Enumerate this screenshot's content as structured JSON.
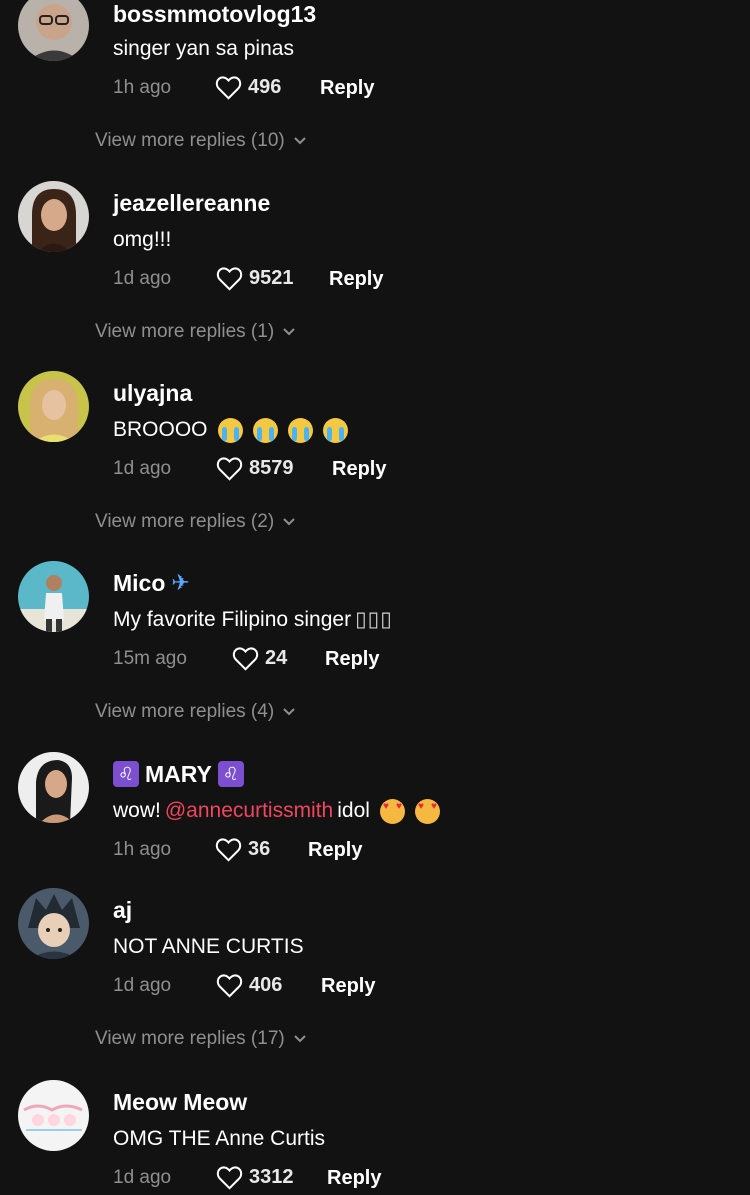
{
  "comments": [
    {
      "username": "bossmmotovlog13",
      "text": "singer yan sa pinas",
      "time": "1h ago",
      "likes": "496",
      "reply_label": "Reply",
      "view_more": "View more replies (10)"
    },
    {
      "username": "jeazellereanne",
      "text": "omg!!!",
      "time": "1d ago",
      "likes": "9521",
      "reply_label": "Reply",
      "view_more": "View more replies (1)"
    },
    {
      "username": "ulyajna",
      "text": "BROOOO",
      "time": "1d ago",
      "likes": "8579",
      "reply_label": "Reply",
      "view_more": "View more replies (2)",
      "emojis": [
        "loudly-crying-face",
        "loudly-crying-face",
        "loudly-crying-face",
        "loudly-crying-face"
      ]
    },
    {
      "username": "Mico",
      "username_icon": "airplane-icon",
      "text": "My favorite Filipino singer",
      "text_suffix": "▯▯▯",
      "time": "15m ago",
      "likes": "24",
      "reply_label": "Reply",
      "view_more": "View more replies (4)"
    },
    {
      "username": "MARY",
      "zodiac_symbol": "♌",
      "text_prefix": "wow!",
      "mention": "@annecurtissmith",
      "text_suffix": "idol",
      "emojis": [
        "smiling-face-with-hearts",
        "smiling-face-with-hearts"
      ],
      "time": "1h ago",
      "likes": "36",
      "reply_label": "Reply"
    },
    {
      "username": "aj",
      "text": "NOT ANNE CURTIS",
      "time": "1d ago",
      "likes": "406",
      "reply_label": "Reply",
      "view_more": "View more replies (17)"
    },
    {
      "username": "Meow Meow",
      "text": "OMG THE Anne Curtis",
      "time": "1d ago",
      "likes": "3312",
      "reply_label": "Reply"
    }
  ],
  "colors": {
    "background": "#121212",
    "text_primary": "#ffffff",
    "text_secondary": "#8f8f8f",
    "mention": "#f0465e"
  }
}
